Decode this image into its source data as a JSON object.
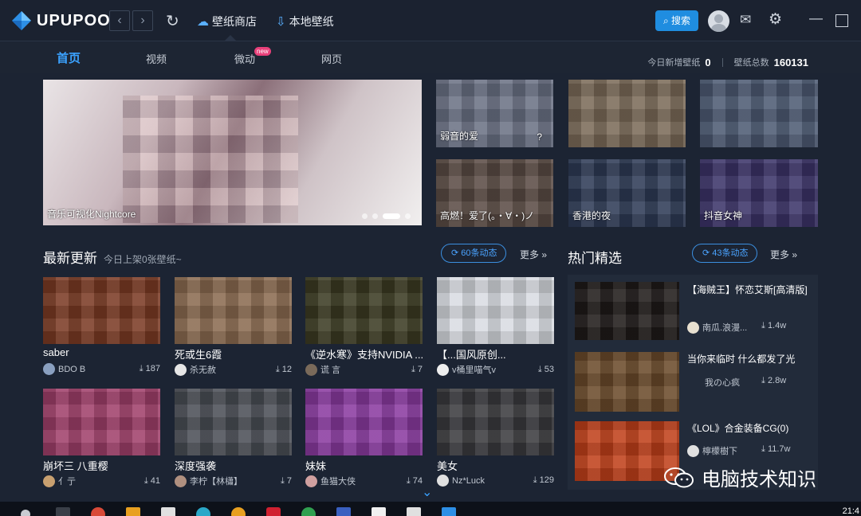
{
  "app": {
    "name": "UPUPOO"
  },
  "nav": {
    "back": "‹",
    "forward": "›"
  },
  "tabs": [
    {
      "label": "壁纸商店",
      "icon": "cloud-icon"
    },
    {
      "label": "本地壁纸",
      "icon": "download-icon"
    }
  ],
  "search": {
    "label": "搜索"
  },
  "subnav": {
    "items": [
      "首页",
      "视频",
      "微动",
      "网页"
    ],
    "badge": "new",
    "stats": {
      "new_label": "今日新增壁纸",
      "new_count": "0",
      "total_label": "壁纸总数",
      "total_count": "160131"
    }
  },
  "hero": {
    "caption": "音乐可视化Nightcore"
  },
  "featured": [
    {
      "caption": "弱音的爱",
      "caption2": "?"
    },
    {
      "caption": ""
    },
    {
      "caption": ""
    },
    {
      "caption": "高燃！爱了(。・∀・)ノ"
    },
    {
      "caption": "香港的夜"
    },
    {
      "caption": "抖音女神"
    }
  ],
  "dynamic_left": {
    "pill": "60条动态",
    "more": "更多"
  },
  "dynamic_right": {
    "pill": "43条动态",
    "more": "更多"
  },
  "latest": {
    "title": "最新更新",
    "subtitle": "今日上架0张壁纸~",
    "cards": [
      {
        "title": "saber",
        "user": "BDO B",
        "downloads": "187"
      },
      {
        "title": "死或生6霞",
        "user": "杀无赦",
        "downloads": "12"
      },
      {
        "title": "《逆水寒》支持NVIDIA ...",
        "user": "谎 言",
        "downloads": "7"
      },
      {
        "title": "【...国风原创...",
        "user": "v桶里喵气v",
        "downloads": "53"
      },
      {
        "title": "崩坏三 八重樱",
        "user": "亻亍",
        "downloads": "41"
      },
      {
        "title": "深度强袭",
        "user": "李柠【林櫹】",
        "downloads": "7"
      },
      {
        "title": "妹妹",
        "user": "鱼猫大侠",
        "downloads": "74"
      },
      {
        "title": "美女",
        "user": "Nz*Luck",
        "downloads": "129"
      }
    ]
  },
  "hot": {
    "title": "热门精选",
    "items": [
      {
        "title": "【海贼王】怀恋艾斯[高清版]",
        "user": "南瓜.浪漫...",
        "downloads": "1.4w"
      },
      {
        "title": "当你来临时 什么都发了光",
        "user": "我の心疯",
        "downloads": "2.8w"
      },
      {
        "title": "《LOL》合金装备CG(0)",
        "user": "檸檬樹下",
        "downloads": "11.7w"
      }
    ]
  },
  "watermark": {
    "text": "电脑技术知识"
  },
  "clock": {
    "time": "21:4"
  },
  "colors": {
    "accent": "#1f8de0",
    "bg": "#1c2433",
    "badge": "#e8407a"
  }
}
